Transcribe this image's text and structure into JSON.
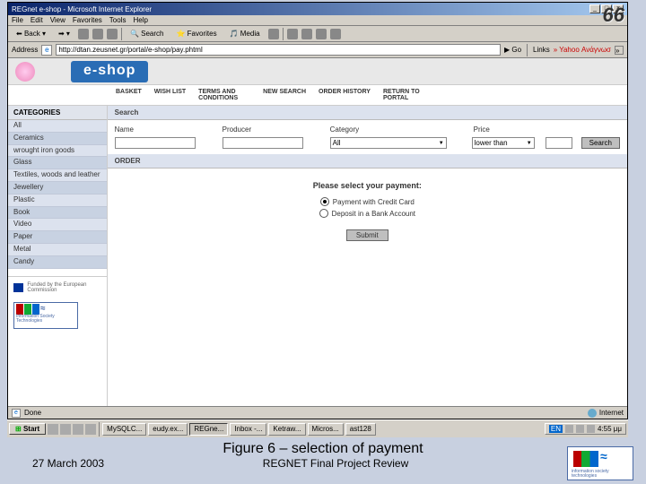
{
  "slide": {
    "number": "66",
    "caption": "Figure 6 – selection of payment",
    "date": "27 March 2003",
    "review": "REGNET Final Project Review",
    "ist_label": "information society technologies"
  },
  "browser": {
    "title": "REGnet e-shop - Microsoft Internet Explorer",
    "menus": [
      "File",
      "Edit",
      "View",
      "Favorites",
      "Tools",
      "Help"
    ],
    "toolbar": {
      "back": "Back",
      "search": "Search",
      "favorites": "Favorites",
      "media": "Media"
    },
    "address_label": "Address",
    "url": "http://dtan.zeusnet.gr/portal/e-shop/pay.phtml",
    "go": "Go",
    "links": "Links",
    "links_item": "Yahoo Ανάγνωσ",
    "status": "Done",
    "zone": "Internet"
  },
  "eshop": {
    "brand": "e-shop",
    "nav": [
      "BASKET",
      "WISH LIST",
      "TERMS AND CONDITIONS",
      "NEW SEARCH",
      "ORDER HISTORY",
      "RETURN TO PORTAL"
    ],
    "sidebar_header": "CATEGORIES",
    "categories": [
      "All",
      "Ceramics",
      "wrought iron goods",
      "Glass",
      "Textiles, woods and leather",
      "Jewellery",
      "Plastic",
      "Book",
      "Video",
      "Paper",
      "Metal",
      "Candy"
    ],
    "funding": "Funded by the European Commission",
    "search": {
      "section": "Search",
      "labels": {
        "name": "Name",
        "producer": "Producer",
        "category": "Category",
        "price": "Price"
      },
      "category_value": "All",
      "price_value": "lower than",
      "button": "Search"
    },
    "order": {
      "section": "ORDER",
      "prompt": "Please select your payment:",
      "options": [
        "Payment with Credit Card",
        "Deposit in a Bank Account"
      ],
      "selected": 0,
      "submit": "Submit"
    }
  },
  "taskbar": {
    "start": "Start",
    "items": [
      "MySQLC...",
      "eudy.ex...",
      "REGne...",
      "Inbox -...",
      "Ketraw...",
      "Micros...",
      "ast128"
    ],
    "tray_lang": "EN",
    "clock": "4:55 μμ"
  }
}
